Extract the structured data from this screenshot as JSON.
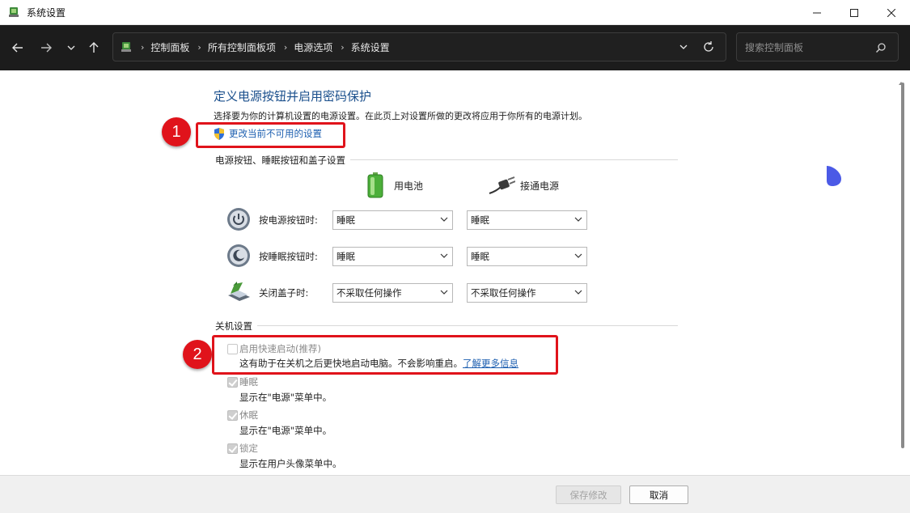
{
  "window": {
    "title": "系统设置"
  },
  "address": {
    "crumbs": [
      "控制面板",
      "所有控制面板项",
      "电源选项",
      "系统设置"
    ]
  },
  "search": {
    "placeholder": "搜索控制面板"
  },
  "page": {
    "heading": "定义电源按钮并启用密码保护",
    "description": "选择要为你的计算机设置的电源设置。在此页上对设置所做的更改将应用于你所有的电源计划。",
    "change_link": "更改当前不可用的设置"
  },
  "power_section": {
    "title": "电源按钮、睡眠按钮和盖子设置",
    "col_battery": "用电池",
    "col_plugged": "接通电源",
    "rows": [
      {
        "label": "按电源按钮时:",
        "battery": "睡眠",
        "plugged": "睡眠"
      },
      {
        "label": "按睡眠按钮时:",
        "battery": "睡眠",
        "plugged": "睡眠"
      },
      {
        "label": "关闭盖子时:",
        "battery": "不采取任何操作",
        "plugged": "不采取任何操作"
      }
    ]
  },
  "shutdown_section": {
    "title": "关机设置",
    "fast_startup": {
      "label": "启用快速启动(推荐)",
      "desc": "这有助于在关机之后更快地启动电脑。不会影响重启。",
      "link": "了解更多信息",
      "checked": false
    },
    "items": [
      {
        "label": "睡眠",
        "desc": "显示在\"电源\"菜单中。",
        "checked": true
      },
      {
        "label": "休眠",
        "desc": "显示在\"电源\"菜单中。",
        "checked": true
      },
      {
        "label": "锁定",
        "desc": "显示在用户头像菜单中。",
        "checked": true
      }
    ]
  },
  "annotations": {
    "badge1": "1",
    "badge2": "2",
    "color": "#e0131b"
  },
  "footer": {
    "save": "保存修改",
    "cancel": "取消"
  }
}
